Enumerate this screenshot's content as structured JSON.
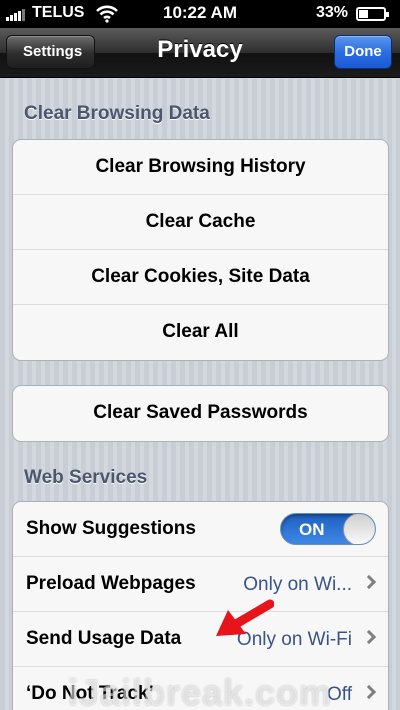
{
  "status_bar": {
    "carrier": "TELUS",
    "time": "10:22 AM",
    "battery": "33%",
    "battery_level": 0.33
  },
  "nav": {
    "back_label": "Settings",
    "title": "Privacy",
    "done_label": "Done"
  },
  "clear_browsing": {
    "header": "Clear Browsing Data",
    "items": [
      "Clear Browsing History",
      "Clear Cache",
      "Clear Cookies, Site Data",
      "Clear All"
    ]
  },
  "passwords": {
    "label": "Clear Saved Passwords"
  },
  "web_services": {
    "header": "Web Services",
    "show_suggestions": {
      "label": "Show Suggestions",
      "toggle": "ON"
    },
    "preload": {
      "label": "Preload Webpages",
      "value": "Only on Wi..."
    },
    "usage": {
      "label": "Send Usage Data",
      "value": "Only on Wi-Fi"
    },
    "dnt": {
      "label": "‘Do Not Track’",
      "value": "Off"
    }
  },
  "watermark": "iJailbreak.com",
  "colors": {
    "done_blue": "#2b6ee0",
    "toggle_blue": "#2f78dc",
    "header_text": "#4c566c",
    "value_text": "#385487",
    "annotation_arrow": "#e8141c"
  }
}
